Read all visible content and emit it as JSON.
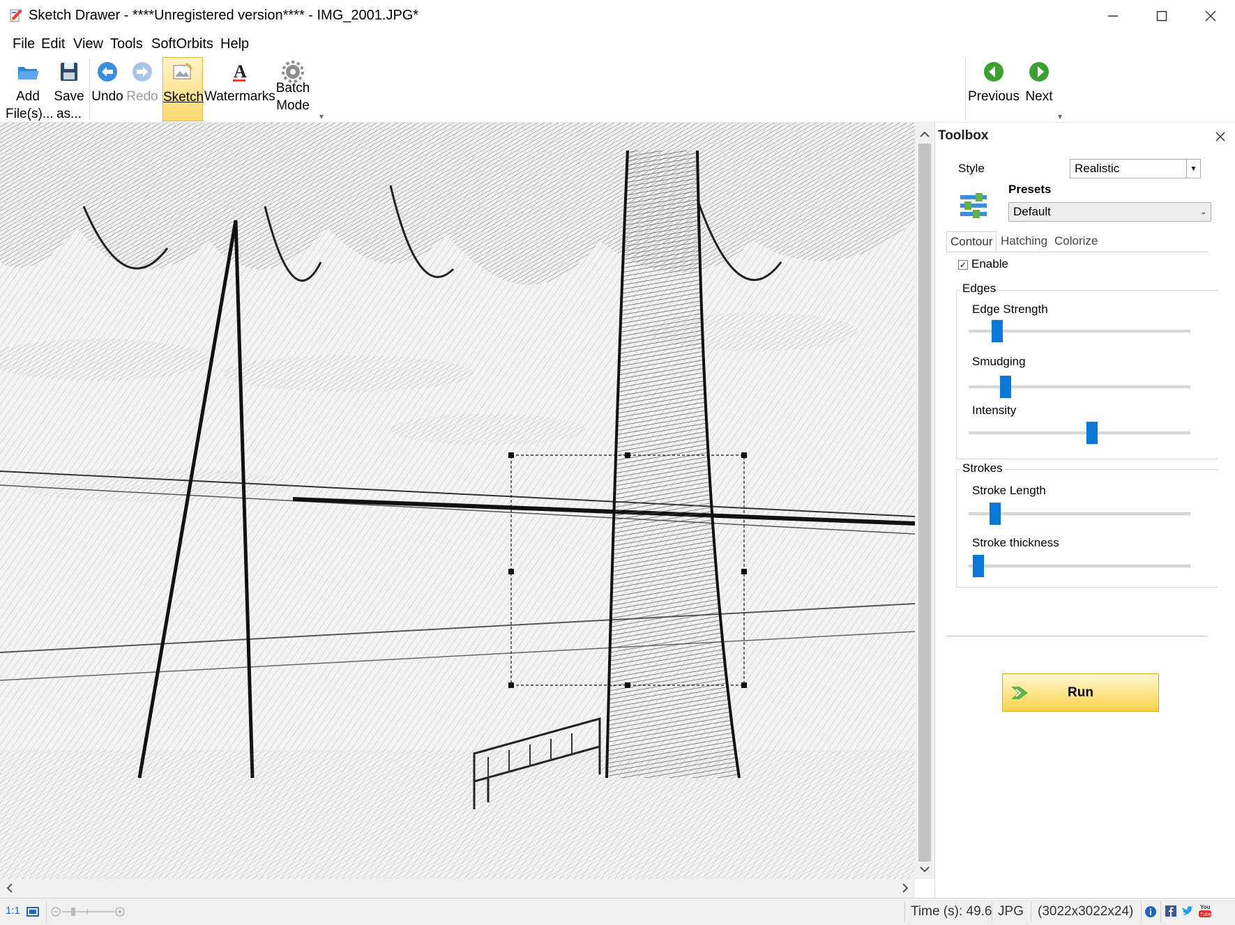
{
  "window": {
    "title": "Sketch Drawer - ****Unregistered version**** - IMG_2001.JPG*"
  },
  "menu": [
    "File",
    "Edit",
    "View",
    "Tools",
    "SoftOrbits",
    "Help"
  ],
  "toolbar": {
    "add_files": "Add\nFile(s)...",
    "save_as": "Save\nas...",
    "undo": "Undo",
    "redo": "Redo",
    "sketch": "Sketch",
    "watermarks": "Watermarks",
    "batch_mode": "Batch\nMode",
    "previous": "Previous",
    "next": "Next"
  },
  "toolbox": {
    "title": "Toolbox",
    "style_label": "Style",
    "style_value": "Realistic",
    "presets_label": "Presets",
    "presets_value": "Default",
    "tabs": [
      "Contour",
      "Hatching",
      "Colorize"
    ],
    "selected_tab": "Contour",
    "enable_label": "Enable",
    "enable_checked": true,
    "edges_group": "Edges",
    "strokes_group": "Strokes",
    "sliders": {
      "edge_strength": {
        "label": "Edge Strength",
        "value": 0.11
      },
      "smudging": {
        "label": "Smudging",
        "value": 0.15
      },
      "intensity": {
        "label": "Intensity",
        "value": 0.56
      },
      "stroke_length": {
        "label": "Stroke Length",
        "value": 0.1
      },
      "stroke_thickness": {
        "label": "Stroke thickness",
        "value": 0.02
      }
    },
    "run_label": "Run"
  },
  "status": {
    "zoom_1to1": "1:1",
    "time": "Time (s): 49.6",
    "format": "JPG",
    "dimensions": "(3022x3022x24)"
  },
  "colors": {
    "accent_blue": "#0a78d7",
    "active_button": "#fcd86e",
    "run_button": "#fbd24b",
    "nav_green": "#3aa12e"
  }
}
